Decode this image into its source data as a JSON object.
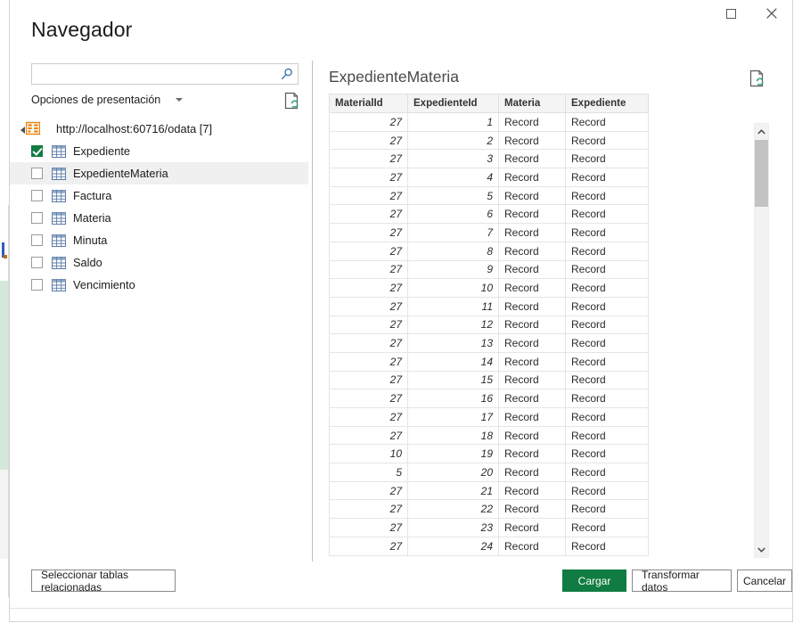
{
  "window": {
    "maximize_icon": "maximize-icon",
    "close_icon": "close-icon"
  },
  "header": {
    "title": "Navegador"
  },
  "left_pane": {
    "search": {
      "value": "",
      "placeholder": "",
      "icon": "search-icon"
    },
    "display_options": {
      "label": "Opciones de presentación",
      "caret_icon": "chevron-down-icon"
    },
    "refresh_icon": "refresh-preview-icon",
    "tree": {
      "root": {
        "label": "http://localhost:60716/odata [7]",
        "expanded": true,
        "icon": "odata-feed-icon",
        "expander_icon": "triangle-expander-icon"
      },
      "items": [
        {
          "label": "Expediente",
          "checked": true,
          "selected": false,
          "icon": "table-icon"
        },
        {
          "label": "ExpedienteMateria",
          "checked": false,
          "selected": true,
          "icon": "table-icon"
        },
        {
          "label": "Factura",
          "checked": false,
          "selected": false,
          "icon": "table-icon"
        },
        {
          "label": "Materia",
          "checked": false,
          "selected": false,
          "icon": "table-icon"
        },
        {
          "label": "Minuta",
          "checked": false,
          "selected": false,
          "icon": "table-icon"
        },
        {
          "label": "Saldo",
          "checked": false,
          "selected": false,
          "icon": "table-icon"
        },
        {
          "label": "Vencimiento",
          "checked": false,
          "selected": false,
          "icon": "table-icon"
        }
      ]
    }
  },
  "right_pane": {
    "preview_title": "ExpedienteMateria",
    "refresh_icon": "refresh-preview-icon",
    "scrollbar": {
      "up_icon": "chevron-up-icon",
      "down_icon": "chevron-down-icon"
    },
    "table": {
      "columns": [
        "MaterialId",
        "ExpedienteId",
        "Materia",
        "Expediente"
      ],
      "column_types": [
        "num",
        "num",
        "text",
        "text"
      ],
      "rows": [
        [
          "27",
          "1",
          "Record",
          "Record"
        ],
        [
          "27",
          "2",
          "Record",
          "Record"
        ],
        [
          "27",
          "3",
          "Record",
          "Record"
        ],
        [
          "27",
          "4",
          "Record",
          "Record"
        ],
        [
          "27",
          "5",
          "Record",
          "Record"
        ],
        [
          "27",
          "6",
          "Record",
          "Record"
        ],
        [
          "27",
          "7",
          "Record",
          "Record"
        ],
        [
          "27",
          "8",
          "Record",
          "Record"
        ],
        [
          "27",
          "9",
          "Record",
          "Record"
        ],
        [
          "27",
          "10",
          "Record",
          "Record"
        ],
        [
          "27",
          "11",
          "Record",
          "Record"
        ],
        [
          "27",
          "12",
          "Record",
          "Record"
        ],
        [
          "27",
          "13",
          "Record",
          "Record"
        ],
        [
          "27",
          "14",
          "Record",
          "Record"
        ],
        [
          "27",
          "15",
          "Record",
          "Record"
        ],
        [
          "27",
          "16",
          "Record",
          "Record"
        ],
        [
          "27",
          "17",
          "Record",
          "Record"
        ],
        [
          "27",
          "18",
          "Record",
          "Record"
        ],
        [
          "10",
          "19",
          "Record",
          "Record"
        ],
        [
          "5",
          "20",
          "Record",
          "Record"
        ],
        [
          "27",
          "21",
          "Record",
          "Record"
        ],
        [
          "27",
          "22",
          "Record",
          "Record"
        ],
        [
          "27",
          "23",
          "Record",
          "Record"
        ],
        [
          "27",
          "24",
          "Record",
          "Record"
        ]
      ]
    }
  },
  "footer": {
    "select_related_label": "Seleccionar tablas relacionadas",
    "load_label": "Cargar",
    "transform_label": "Transformar datos",
    "cancel_label": "Cancelar"
  },
  "colors": {
    "accent_green": "#107c41",
    "odata_orange": "#e8820c",
    "table_icon_blue": "#5b7ca8",
    "selected_row": "#f0f0f0",
    "header_fill": "#f4f4f4"
  }
}
